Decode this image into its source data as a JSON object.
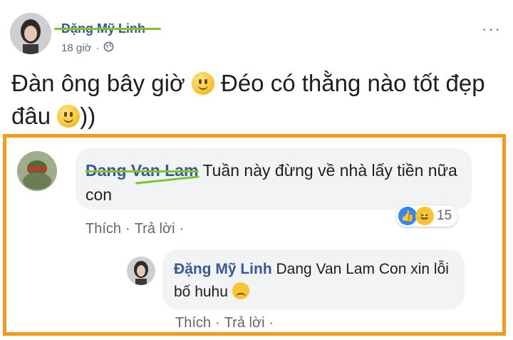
{
  "post": {
    "author": "Đặng Mỹ Linh",
    "time": "18 giờ",
    "separator": "·",
    "more": "···",
    "text_part1": "Đàn ông bây giờ",
    "text_part2": "Đéo có thằng nào tốt đẹp đâu",
    "text_end": "))"
  },
  "comment1": {
    "author": "Dang Van Lam",
    "text": "Tuần này đừng về nhà lấy tiền nữa con",
    "reaction_count": "15",
    "actions": {
      "like": "Thích",
      "dot": "·",
      "reply": "Trả lời",
      "dot2": "·"
    }
  },
  "reply1": {
    "author": "Đặng Mỹ Linh",
    "mention": "Dang Van Lam",
    "text": "Con xin lỗi bố huhu",
    "actions": {
      "like": "Thích",
      "dot": "·",
      "reply": "Trả lời",
      "dot2": "·"
    }
  },
  "colors": {
    "name_link": "#385898",
    "orange_border": "#f39c1c",
    "highlight": "#7cc52b",
    "bubble": "#f2f3f5"
  }
}
